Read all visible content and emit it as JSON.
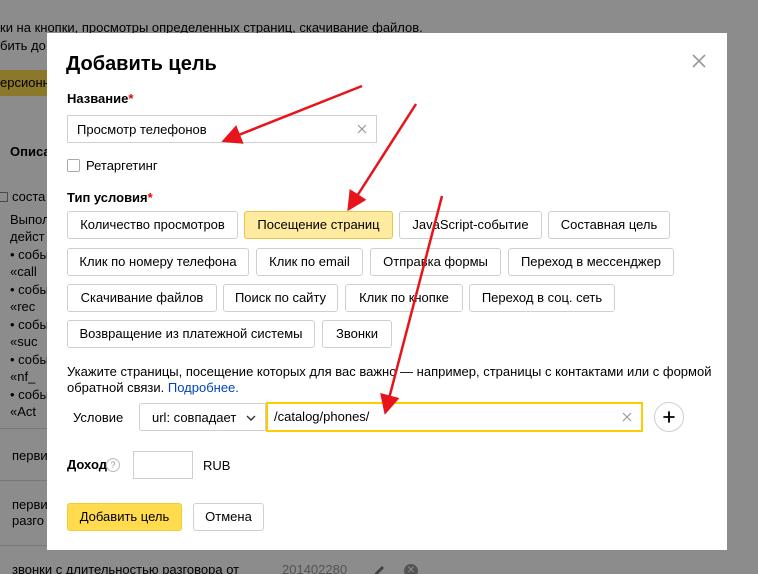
{
  "background": {
    "top_line1": "ки на кнопки, просмотры определенных страниц, скачивание файлов.",
    "top_line2": "бить до",
    "badge": "ерсионн",
    "opis": "Описа",
    "sost": "соста",
    "list_lines": [
      "Выпол",
      "дейст",
      "• собы",
      "  «call",
      "• собы",
      "  «rec",
      "• собы",
      "  «suc",
      "• собы",
      "  «nf_",
      "• собы",
      "  «Act"
    ],
    "pervi1": "перви",
    "pervi2_line1": "перви",
    "pervi2_line2": "разго",
    "bottom": "звонки с длительностью разговора от",
    "bottom_num": "201402280"
  },
  "modal": {
    "title": "Добавить цель",
    "name_label": "Название",
    "required_mark": "*",
    "name_value": "Просмотр телефонов",
    "retargeting_label": "Ретаргетинг",
    "type_label": "Тип условия",
    "condition_types": [
      "Количество просмотров",
      "Посещение страниц",
      "JavaScript-событие",
      "Составная цель",
      "Клик по номеру телефона",
      "Клик по email",
      "Отправка формы",
      "Переход в мессенджер",
      "Скачивание файлов",
      "Поиск по сайту",
      "Клик по кнопке",
      "Переход в соц. сеть",
      "Возвращение из платежной системы",
      "Звонки"
    ],
    "active_type": "Посещение страниц",
    "description": "Укажите страницы, посещение которых для вас важно — например, страницы с контактами или с формой обратной связи.",
    "more_link": "Подробнее.",
    "condition_label": "Условие",
    "condition_select": "url: совпадает",
    "condition_value": "/catalog/phones/",
    "income_label": "Доход",
    "currency": "RUB",
    "add_button": "Добавить цель",
    "cancel_button": "Отмена"
  },
  "colors": {
    "accent": "#ffdb4d",
    "active_chip": "#ffeba0",
    "link": "#0044bb",
    "required": "#ee0000",
    "annotation_arrow": "#e8141b"
  }
}
